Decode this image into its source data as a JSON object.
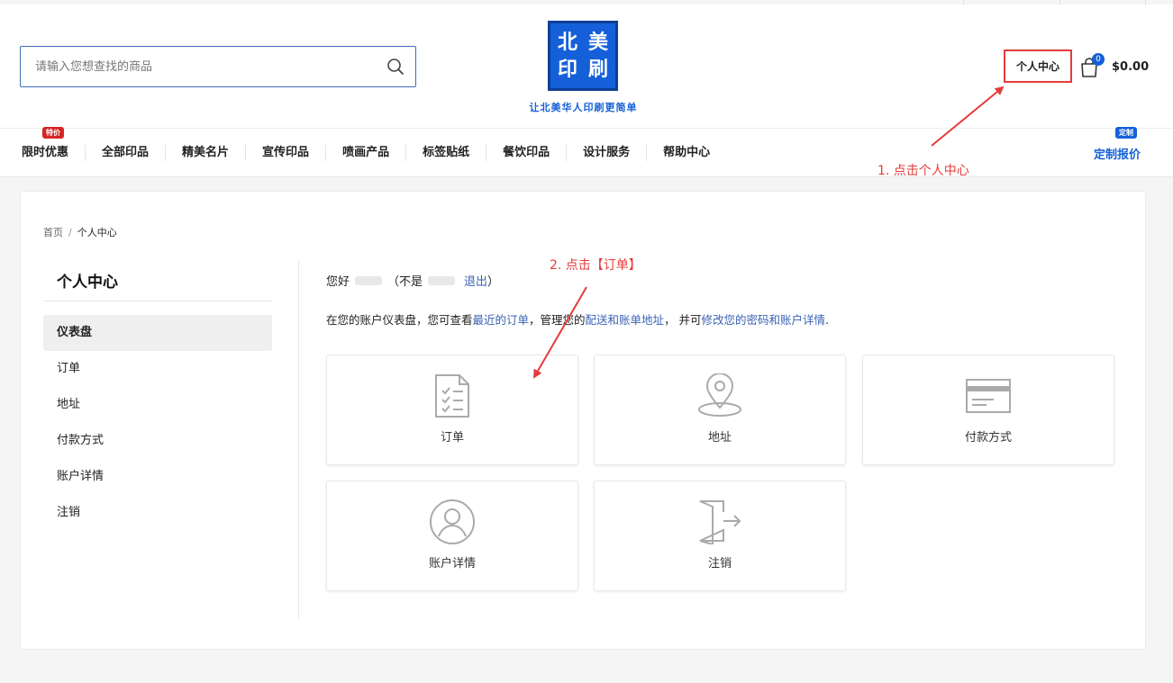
{
  "header": {
    "search": {
      "placeholder": "请输入您想查找的商品"
    },
    "logo": {
      "chars": [
        "北",
        "美",
        "印",
        "刷"
      ],
      "tagline": "让北美华人印刷更简单"
    },
    "account_label": "个人中心",
    "cart": {
      "count": "0",
      "total": "$0.00"
    }
  },
  "nav": {
    "items": [
      "限时优惠",
      "全部印品",
      "精美名片",
      "宣传印品",
      "喷画产品",
      "标签贴纸",
      "餐饮印品",
      "设计服务",
      "帮助中心"
    ],
    "hot_badge": "特价",
    "custom_badge": "定制",
    "custom_link": "定制报价"
  },
  "annotations": {
    "step1": "1. 点击个人中心",
    "step2": "2. 点击【订单】",
    "color": "#e53b3b"
  },
  "breadcrumb": {
    "home": "首页",
    "separator": "/",
    "current": "个人中心"
  },
  "sidebar": {
    "title": "个人中心",
    "items": [
      "仪表盘",
      "订单",
      "地址",
      "付款方式",
      "账户详情",
      "注销"
    ],
    "active_index": 0
  },
  "dashboard": {
    "hello_prefix": "您好",
    "not_prefix": "（不是",
    "not_suffix": "）",
    "logout": "退出",
    "intro_1": "在您的账户仪表盘，您可查看",
    "intro_link_orders": "最近的订单",
    "intro_2": "，管理您的",
    "intro_link_address": "配送和账单地址",
    "intro_3": "， 并可",
    "intro_link_account": "修改您的密码和账户详情",
    "intro_4": ".",
    "tiles": [
      {
        "label": "订单",
        "icon": "order-list-icon"
      },
      {
        "label": "地址",
        "icon": "location-pin-icon"
      },
      {
        "label": "付款方式",
        "icon": "credit-card-icon"
      },
      {
        "label": "账户详情",
        "icon": "user-icon"
      },
      {
        "label": "注销",
        "icon": "logout-door-icon"
      }
    ]
  },
  "colors": {
    "brand_blue": "#1560d8",
    "link_blue": "#3a62b4",
    "accent_red": "#e53b3b"
  }
}
